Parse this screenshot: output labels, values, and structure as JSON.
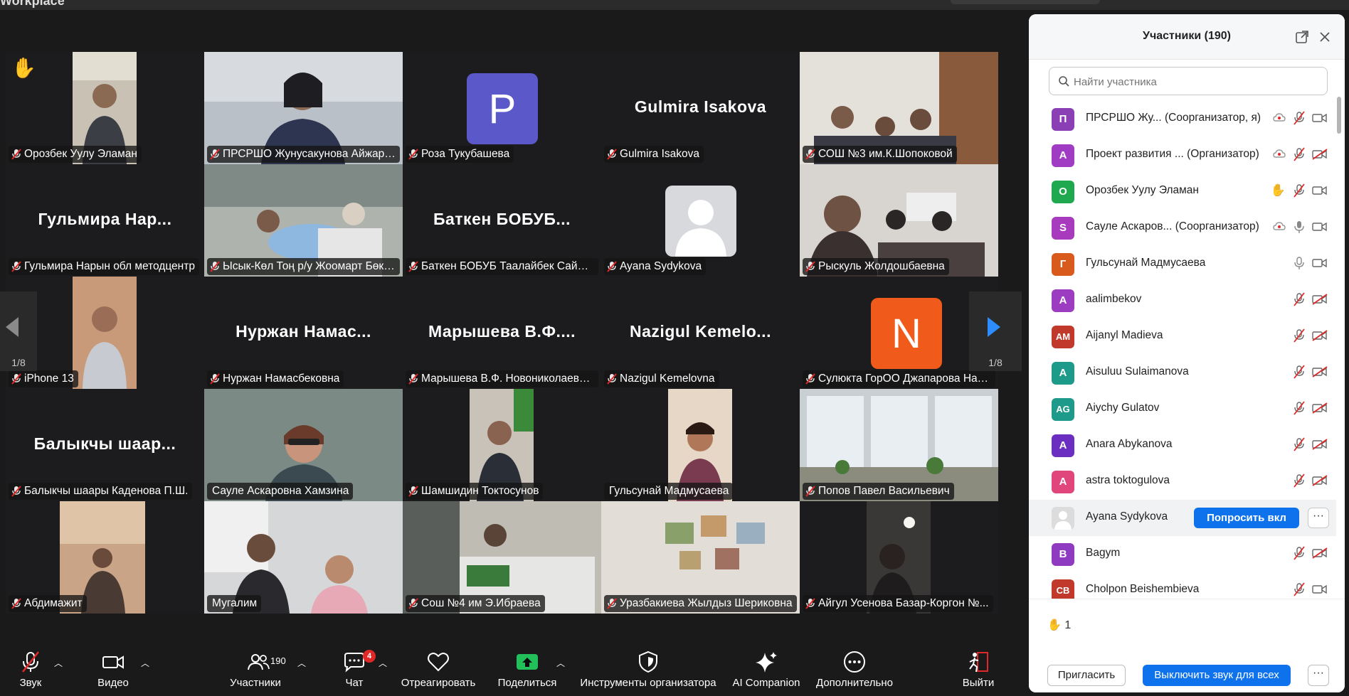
{
  "window": {
    "title": "Workplace"
  },
  "grid": {
    "page_indicator": "1/8",
    "tiles": [
      {
        "label": "Орозбек Уулу Эламан"
      },
      {
        "label": "ПРСРШО Жунусакунова Айжарк..."
      },
      {
        "label": "Роза Тукубашева",
        "avatar_letter": "P"
      },
      {
        "label": "Gulmira Isakova",
        "big_name": "Gulmira Isakova"
      },
      {
        "label": "СОШ №3 им.К.Шопоковой"
      },
      {
        "label": "Гульмира Нарын обл методцентр",
        "big_name": "Гульмира  Нар..."
      },
      {
        "label": "Ысык-Көл Тоң р/у Жоомарт Бөкө..."
      },
      {
        "label": "Баткен БОБУБ Таалайбек Сайитк...",
        "big_name": "Баткен  БОБУБ..."
      },
      {
        "label": "Ayana Sydykova"
      },
      {
        "label": "Рыскуль Жолдошбаевна"
      },
      {
        "label": "iPhone 13"
      },
      {
        "label": "Нуржан Намасбековна",
        "big_name": "Нуржан  Намас..."
      },
      {
        "label": "Марышева В.Ф. Новониколаевск...",
        "big_name": "Марышева  В.Ф...."
      },
      {
        "label": "Nazigul Kemelovna",
        "big_name": "Nazigul  Kemelo..."
      },
      {
        "label": "Сулюкта ГорОО Джапарова Наз...",
        "avatar_letter": "N"
      },
      {
        "label": "Балыкчы шаары Каденова П.Ш.",
        "big_name": "Балыкчы  шаар..."
      },
      {
        "label": "Сауле Аскаровна Хамзина"
      },
      {
        "label": "Шамшидин Токтосунов"
      },
      {
        "label": "Гульсунай Мадмусаева"
      },
      {
        "label": "Попов Павел Васильевич"
      },
      {
        "label": "Абдимажит"
      },
      {
        "label": "Мугалим"
      },
      {
        "label": "Сош №4 им Э.Ибраева"
      },
      {
        "label": "Уразбакиева Жылдыз Шериковна"
      },
      {
        "label": "Айгул  Усенова Базар-Коргон №..."
      }
    ]
  },
  "toolbar": {
    "audio": "Звук",
    "video": "Видео",
    "participants": "Участники",
    "participants_count": "190",
    "chat": "Чат",
    "chat_badge": "4",
    "react": "Отреагировать",
    "share": "Поделиться",
    "host_tools": "Инструменты организатора",
    "ai_companion": "AI Companion",
    "more": "Дополнительно",
    "leave": "Выйти"
  },
  "panel": {
    "title": "Участники (190)",
    "search_placeholder": "Найти участника",
    "participants": [
      {
        "initials": "П",
        "name": "ПРСРШО Жу...",
        "role": "(Соорганизатор, я)",
        "color": "#8b3fb5"
      },
      {
        "initials": "А",
        "name": "Проект развития ...",
        "role": "(Организатор)",
        "color": "#a03cc4"
      },
      {
        "initials": "О",
        "name": "Орозбек Уулу Эламан",
        "role": "",
        "color": "#1fa84f"
      },
      {
        "initials": "S",
        "name": "Сауле Аскаров...",
        "role": "(Соорганизатор)",
        "color": "#a83bbd"
      },
      {
        "initials": "Г",
        "name": "Гульсунай Мадмусаева",
        "role": "",
        "color": "#d85a1c"
      },
      {
        "initials": "A",
        "name": "aalimbekov",
        "role": "",
        "color": "#9c3cc0"
      },
      {
        "initials": "AM",
        "name": "Aijanyl Madieva",
        "role": "",
        "color": "#c0392b"
      },
      {
        "initials": "A",
        "name": "Aisuluu Sulaimanova",
        "role": "",
        "color": "#1d9a8a"
      },
      {
        "initials": "AG",
        "name": "Aiychy Gulatov",
        "role": "",
        "color": "#1d9a8a"
      },
      {
        "initials": "A",
        "name": "Anara Abykanova",
        "role": "",
        "color": "#6a2fc0"
      },
      {
        "initials": "A",
        "name": "astra toktogulova",
        "role": "",
        "color": "#e0457b"
      },
      {
        "initials": "",
        "name": "Ayana Sydykova",
        "role": "",
        "color": "#dcdcdc"
      },
      {
        "initials": "B",
        "name": "Bagym",
        "role": "",
        "color": "#8e3bc2"
      },
      {
        "initials": "CB",
        "name": "Cholpon Beishembieva",
        "role": "",
        "color": "#c0392b"
      }
    ],
    "ask_unmute": "Попросить вкл",
    "more_dots": "···",
    "raised_hands": "1",
    "invite": "Пригласить",
    "mute_all": "Выключить звук для всех",
    "footer_more": "···"
  }
}
